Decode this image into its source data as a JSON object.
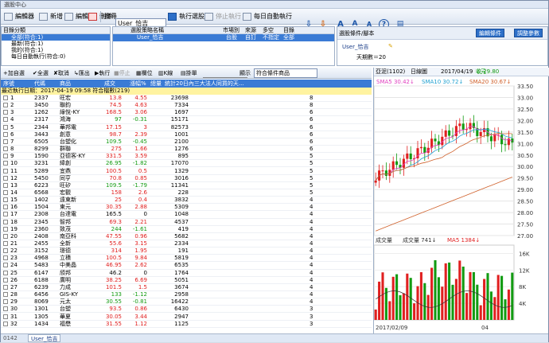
{
  "window_title": "選股中心",
  "toolbar": {
    "items": [
      "編輯器",
      "新增",
      "編輯",
      "刪除"
    ],
    "search_label": "搜尋",
    "user_field": "User_恰吉",
    "run_btn": "執行選股",
    "stop_btn": "停止執行",
    "daily_btn": "每日自動執行"
  },
  "left_panel": {
    "header": "目錄分類",
    "items": [
      "全部(符合:1)",
      "最新(符合:1)",
      "我的(符合:1)",
      "每日自動執行(符合:0)"
    ]
  },
  "mid_panel": {
    "headers": [
      "選股策略名稱",
      "市場別",
      "來源",
      "多空",
      "目錄"
    ],
    "row": [
      "User_恰吉",
      "台股",
      "自訂",
      "不指定",
      "全部"
    ]
  },
  "right_panel": {
    "header": "選股條件/腳本",
    "script_name": "User_恰吉",
    "period": "天期數＝20",
    "btn_edit": "編輯條件",
    "btn_params": "調整參數"
  },
  "grid_toolbar": {
    "items": [
      "加自選",
      "全選",
      "取消",
      "匯出",
      "執行",
      "停止",
      "欄位",
      "K線",
      "掛單"
    ],
    "display_label": "顯示",
    "filter": "符合條件商品"
  },
  "table": {
    "headers": [
      "序號",
      "代碼",
      "商品",
      "成交",
      "漲幅%",
      "總量",
      "統計20日內三大法人同買的天..."
    ],
    "info": "最近執行日期：2017-04-19 09:58 符合檔數(219)",
    "rows": [
      [
        "1",
        "2337",
        "旺宏",
        "13.8",
        "4.55",
        "23698",
        "8"
      ],
      [
        "2",
        "3450",
        "聯鈞",
        "74.5",
        "4.63",
        "7334",
        "8"
      ],
      [
        "3",
        "1262",
        "綠悅-KY",
        "168.5",
        "3.06",
        "1697",
        "6"
      ],
      [
        "4",
        "2317",
        "鴻海",
        "97",
        "-0.31",
        "15171",
        "6"
      ],
      [
        "5",
        "2344",
        "華邦電",
        "17.15",
        "3",
        "82573",
        "6"
      ],
      [
        "6",
        "3443",
        "創意",
        "98.7",
        "2.39",
        "1001",
        "6"
      ],
      [
        "7",
        "6505",
        "台塑化",
        "109.5",
        "-0.45",
        "2100",
        "6"
      ],
      [
        "8",
        "8299",
        "群聯",
        "275",
        "1.66",
        "1276",
        "6"
      ],
      [
        "9",
        "1590",
        "亞德客-KY",
        "331.5",
        "3.59",
        "895",
        "5"
      ],
      [
        "10",
        "3231",
        "緯創",
        "26.95",
        "-1.82",
        "17070",
        "5"
      ],
      [
        "11",
        "5289",
        "宜鼎",
        "100.5",
        "0.5",
        "1329",
        "5"
      ],
      [
        "12",
        "5450",
        "同亨",
        "70.8",
        "0.85",
        "3016",
        "5"
      ],
      [
        "13",
        "6223",
        "旺矽",
        "109.5",
        "-1.79",
        "11341",
        "5"
      ],
      [
        "14",
        "6568",
        "宏觀",
        "158",
        "2.6",
        "228",
        "5"
      ],
      [
        "15",
        "1402",
        "遠東新",
        "25",
        "0.4",
        "3832",
        "4"
      ],
      [
        "16",
        "1504",
        "東元",
        "30.35",
        "2.88",
        "5309",
        "4"
      ],
      [
        "17",
        "2308",
        "台達電",
        "165.5",
        "0",
        "1048",
        "4"
      ],
      [
        "18",
        "2345",
        "智邦",
        "69.3",
        "2.21",
        "4537",
        "4"
      ],
      [
        "19",
        "2360",
        "致茂",
        "244",
        "-1.61",
        "419",
        "4"
      ],
      [
        "20",
        "2408",
        "南亞科",
        "47.55",
        "0.96",
        "5682",
        "4"
      ],
      [
        "21",
        "2455",
        "全新",
        "55.6",
        "3.15",
        "2334",
        "4"
      ],
      [
        "22",
        "3152",
        "璟德",
        "314",
        "1.95",
        "191",
        "4"
      ],
      [
        "23",
        "4968",
        "立積",
        "100.5",
        "9.84",
        "5819",
        "4"
      ],
      [
        "24",
        "5483",
        "中美晶",
        "46.95",
        "2.62",
        "6535",
        "4"
      ],
      [
        "25",
        "6147",
        "頎邦",
        "46.2",
        "0",
        "1764",
        "4"
      ],
      [
        "26",
        "6188",
        "廣明",
        "38.25",
        "6.69",
        "5051",
        "4"
      ],
      [
        "27",
        "6239",
        "力成",
        "101.5",
        "1.5",
        "3674",
        "4"
      ],
      [
        "28",
        "6456",
        "GIS-KY",
        "133",
        "-1.12",
        "2958",
        "4"
      ],
      [
        "29",
        "8069",
        "元太",
        "30.55",
        "-0.81",
        "16422",
        "4"
      ],
      [
        "30",
        "1301",
        "台塑",
        "93.5",
        "0.86",
        "6430",
        "3"
      ],
      [
        "31",
        "1305",
        "華夏",
        "30.05",
        "3.44",
        "2947",
        "3"
      ],
      [
        "32",
        "1434",
        "福懋",
        "31.55",
        "1.12",
        "1125",
        "3"
      ]
    ]
  },
  "chart": {
    "title": "亞泥(1102)",
    "period": "日線圖",
    "date": "2017/04/19",
    "close": "收 29.80",
    "unit": "元",
    "sma5": "SMA5 30.42",
    "sma10": "SMA10 30.72",
    "sma20": "SMA20 30.67",
    "price_ticks": [
      "33.50",
      "33.00",
      "32.50",
      "32.00",
      "31.50",
      "31.00",
      "30.50",
      "30.00",
      "29.50",
      "29.00",
      "28.50",
      "28.00",
      "27.50",
      "27.00"
    ],
    "vol_label": "成交量",
    "vol_value": "成交量 741",
    "ma5_vol": "MA5 1384",
    "vol_ticks": [
      "16K",
      "12K",
      "8K",
      "4K"
    ],
    "x_labels": [
      "2017/02/09",
      "04"
    ],
    "colors": {
      "up": "#e02020",
      "down": "#129b12",
      "sma5": "#e040c0",
      "sma10": "#20a0d0",
      "sma20": "#d0602a"
    }
  },
  "bottom_tab": "User_恰吉",
  "bottom_left": "0142"
}
